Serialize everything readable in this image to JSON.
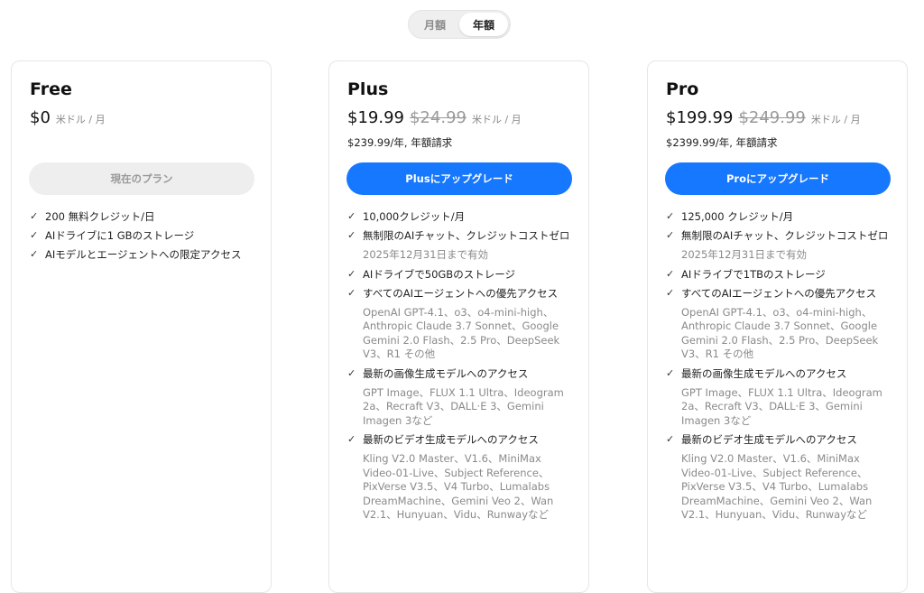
{
  "toggle": {
    "monthly_label": "月額",
    "yearly_label": "年額",
    "active": "yearly"
  },
  "plans": [
    {
      "name": "Free",
      "price": "$0",
      "unit": "米ドル / 月",
      "button": "現在のプラン",
      "features": [
        {
          "text": "200 無料クレジット/日"
        },
        {
          "text": "AIドライブに1 GBのストレージ"
        },
        {
          "text": "AIモデルとエージェントへの限定アクセス"
        }
      ]
    },
    {
      "name": "Plus",
      "price": "$19.99",
      "old_price": "$24.99",
      "unit": "米ドル / 月",
      "billing": "$239.99/年, 年額請求",
      "button": "Plusにアップグレード",
      "features": [
        {
          "text": "10,000クレジット/月"
        },
        {
          "text": "無制限のAIチャット、クレジットコストゼロ",
          "sub": "2025年12月31日まで有効"
        },
        {
          "text": "AIドライブで50GBのストレージ"
        },
        {
          "text": "すべてのAIエージェントへの優先アクセス",
          "sub": "OpenAI GPT-4.1、o3、o4-mini-high、Anthropic Claude 3.7 Sonnet、Google Gemini 2.0 Flash、2.5 Pro、DeepSeek V3、R1 その他"
        },
        {
          "text": "最新の画像生成モデルへのアクセス",
          "sub": "GPT Image、FLUX 1.1 Ultra、Ideogram 2a、Recraft V3、DALL·E 3、Gemini Imagen 3など"
        },
        {
          "text": "最新のビデオ生成モデルへのアクセス",
          "sub": "Kling V2.0 Master、V1.6、MiniMax Video-01-Live、Subject Reference、PixVerse V3.5、V4 Turbo、Lumalabs DreamMachine、Gemini Veo 2、Wan V2.1、Hunyuan、Vidu、Runwayなど"
        }
      ]
    },
    {
      "name": "Pro",
      "price": "$199.99",
      "old_price": "$249.99",
      "unit": "米ドル / 月",
      "billing": "$2399.99/年, 年額請求",
      "button": "Proにアップグレード",
      "features": [
        {
          "text": "125,000 クレジット/月"
        },
        {
          "text": "無制限のAIチャット、クレジットコストゼロ",
          "sub": "2025年12月31日まで有効"
        },
        {
          "text": "AIドライブで1TBのストレージ"
        },
        {
          "text": "すべてのAIエージェントへの優先アクセス",
          "sub": "OpenAI GPT-4.1、o3、o4-mini-high、Anthropic Claude 3.7 Sonnet、Google Gemini 2.0 Flash、2.5 Pro、DeepSeek V3、R1 その他"
        },
        {
          "text": "最新の画像生成モデルへのアクセス",
          "sub": "GPT Image、FLUX 1.1 Ultra、Ideogram 2a、Recraft V3、DALL·E 3、Gemini Imagen 3など"
        },
        {
          "text": "最新のビデオ生成モデルへのアクセス",
          "sub": "Kling V2.0 Master、V1.6、MiniMax Video-01-Live、Subject Reference、PixVerse V3.5、V4 Turbo、Lumalabs DreamMachine、Gemini Veo 2、Wan V2.1、Hunyuan、Vidu、Runwayなど"
        }
      ]
    }
  ],
  "check_glyph": "✓",
  "colors": {
    "accent": "#1677ff",
    "muted": "#8a8a8a",
    "disabled_bg": "#eeeeee"
  }
}
